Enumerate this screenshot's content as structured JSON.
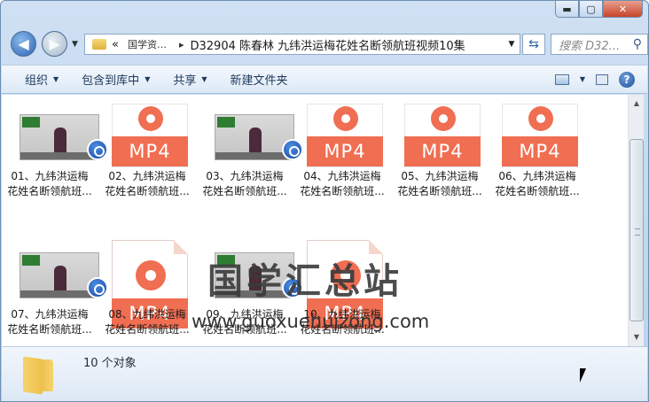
{
  "window": {
    "caption": {
      "minimize": "▬",
      "maximize": "▢",
      "close": "✕"
    }
  },
  "nav": {
    "history_arrow": "▼",
    "breadcrumb": [
      "«",
      "国学资…",
      "D32904  陈春林 九纬洪运梅花姓名断领航班视频10集"
    ],
    "crumb_sep": "▸",
    "dropdown": "▼",
    "refresh": "⇆",
    "search_placeholder": "搜索 D32...",
    "search_icon": "search-icon"
  },
  "toolbar": {
    "organize": "组织",
    "include": "包含到库中",
    "share": "共享",
    "new_folder": "新建文件夹",
    "arrow": "▼"
  },
  "files": [
    {
      "line1": "01、九纬洪运梅",
      "line2": "花姓名断领航班...",
      "kind": "video"
    },
    {
      "line1": "02、九纬洪运梅",
      "line2": "花姓名断领航班...",
      "kind": "mp4"
    },
    {
      "line1": "03、九纬洪运梅",
      "line2": "花姓名断领航班...",
      "kind": "video"
    },
    {
      "line1": "04、九纬洪运梅",
      "line2": "花姓名断领航班...",
      "kind": "mp4"
    },
    {
      "line1": "05、九纬洪运梅",
      "line2": "花姓名断领航班...",
      "kind": "mp4"
    },
    {
      "line1": "06、九纬洪运梅",
      "line2": "花姓名断领航班...",
      "kind": "mp4"
    },
    {
      "line1": "07、九纬洪运梅",
      "line2": "花姓名断领航班...",
      "kind": "video"
    },
    {
      "line1": "08、九纬洪运梅",
      "line2": "花姓名断领航班...",
      "kind": "mp4"
    },
    {
      "line1": "09、九纬洪运梅",
      "line2": "花姓名断领航班...",
      "kind": "video"
    },
    {
      "line1": "10、九纬洪运梅",
      "line2": "花姓名断领航班...",
      "kind": "mp4"
    }
  ],
  "mp4_label": "MP4",
  "watermark": {
    "text": "国学汇总站",
    "url": "www.guoxuehuizong.com"
  },
  "details": {
    "count": "10 个对象"
  }
}
